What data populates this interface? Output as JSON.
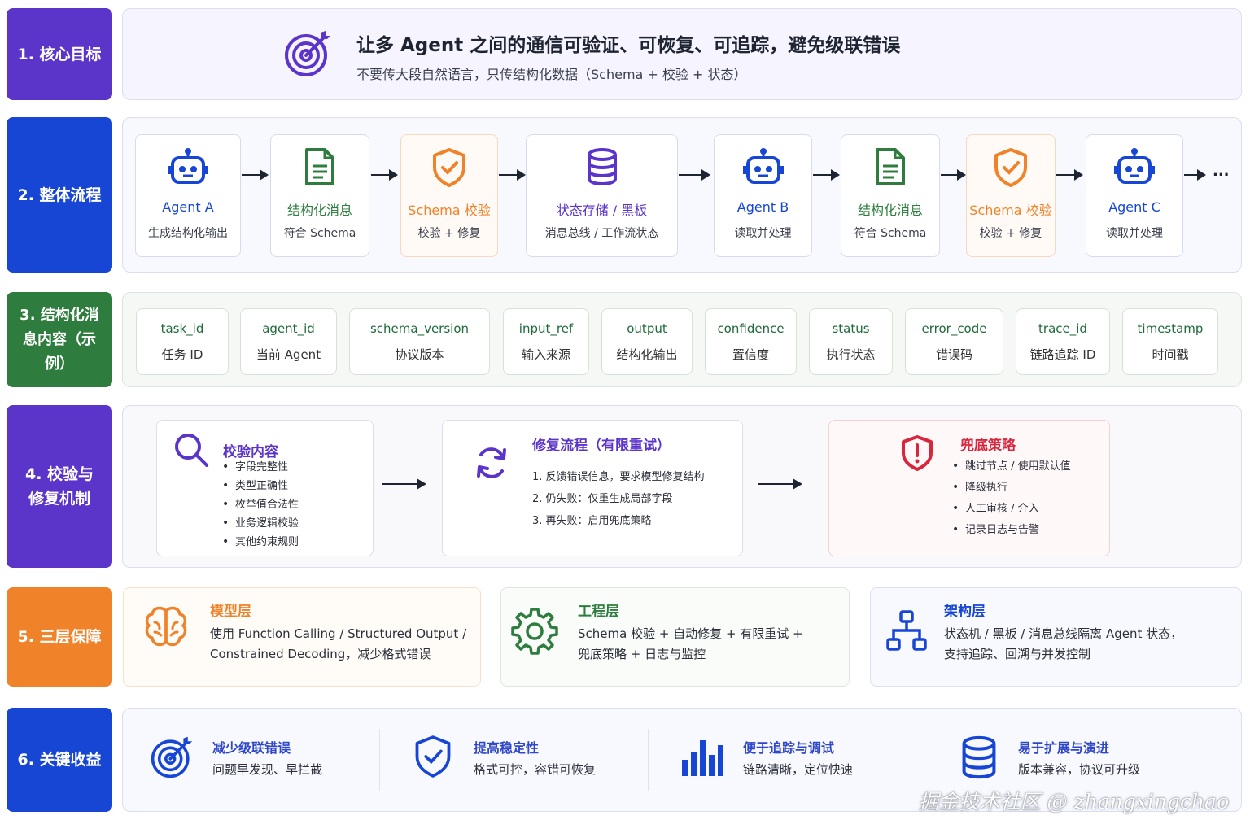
{
  "labels": {
    "l1": "1. 核心目标",
    "l2": "2. 整体流程",
    "l3": "3. 结构化消息内容（示例）",
    "l4": "4. 校验与修复机制",
    "l5": "5. 三层保障",
    "l6": "6. 关键收益"
  },
  "goal": {
    "title": "让多 Agent 之间的通信可验证、可恢复、可追踪，避免级联错误",
    "subtitle": "不要传大段自然语言，只传结构化数据（Schema + 校验 + 状态）"
  },
  "flow": [
    {
      "title": "Agent A",
      "sub": "生成结构化输出",
      "icon": "robot-icon"
    },
    {
      "title": "结构化消息",
      "sub": "符合 Schema",
      "icon": "document-icon"
    },
    {
      "title": "Schema 校验",
      "sub": "校验 + 修复",
      "icon": "shield-check-icon"
    },
    {
      "title": "状态存储 / 黑板",
      "sub": "消息总线 / 工作流状态",
      "icon": "database-icon"
    },
    {
      "title": "Agent B",
      "sub": "读取并处理",
      "icon": "robot-icon"
    },
    {
      "title": "结构化消息",
      "sub": "符合 Schema",
      "icon": "document-icon"
    },
    {
      "title": "Schema 校验",
      "sub": "校验 + 修复",
      "icon": "shield-check-icon"
    },
    {
      "title": "Agent C",
      "sub": "读取并处理",
      "icon": "robot-icon"
    }
  ],
  "flow_more": "...",
  "fields": [
    {
      "key": "task_id",
      "desc": "任务 ID"
    },
    {
      "key": "agent_id",
      "desc": "当前 Agent"
    },
    {
      "key": "schema_version",
      "desc": "协议版本"
    },
    {
      "key": "input_ref",
      "desc": "输入来源"
    },
    {
      "key": "output",
      "desc": "结构化输出"
    },
    {
      "key": "confidence",
      "desc": "置信度"
    },
    {
      "key": "status",
      "desc": "执行状态"
    },
    {
      "key": "error_code",
      "desc": "错误码"
    },
    {
      "key": "trace_id",
      "desc": "链路追踪 ID"
    },
    {
      "key": "timestamp",
      "desc": "时间戳"
    }
  ],
  "validation": {
    "title": "校验内容",
    "items": [
      "字段完整性",
      "类型正确性",
      "枚举值合法性",
      "业务逻辑校验",
      "其他约束规则"
    ]
  },
  "repair": {
    "title": "修复流程（有限重试）",
    "items": [
      "1.  反馈错误信息，要求模型修复结构",
      "2.  仍失败：仅重生成局部字段",
      "3.  再失败：启用兜底策略"
    ]
  },
  "fallback": {
    "title": "兜底策略",
    "items": [
      "跳过节点 / 使用默认值",
      "降级执行",
      "人工审核 / 介入",
      "记录日志与告警"
    ]
  },
  "layers": [
    {
      "title": "模型层",
      "line1": "使用 Function Calling / Structured Output /",
      "line2": "Constrained Decoding，减少格式错误",
      "icon": "brain-icon"
    },
    {
      "title": "工程层",
      "line1": "Schema 校验 + 自动修复 + 有限重试 +",
      "line2": "兜底策略 + 日志与监控",
      "icon": "gear-icon"
    },
    {
      "title": "架构层",
      "line1": "状态机 / 黑板 / 消息总线隔离 Agent 状态，",
      "line2": "支持追踪、回溯与并发控制",
      "icon": "hierarchy-icon"
    }
  ],
  "benefits": [
    {
      "title": "减少级联错误",
      "sub": "问题早发现、早拦截",
      "icon": "target-icon"
    },
    {
      "title": "提高稳定性",
      "sub": "格式可控，容错可恢复",
      "icon": "shield-check-icon"
    },
    {
      "title": "便于追踪与调试",
      "sub": "链路清晰，定位快速",
      "icon": "bar-chart-icon"
    },
    {
      "title": "易于扩展与演进",
      "sub": "版本兼容，协议可升级",
      "icon": "database-icon"
    }
  ],
  "watermark": "掘金技术社区 @ zhangxingchao",
  "colors": {
    "purple": "#5b34c9",
    "blue": "#1846d4",
    "green": "#2e7d3e",
    "orange": "#f0822a",
    "red": "#d7263d"
  }
}
